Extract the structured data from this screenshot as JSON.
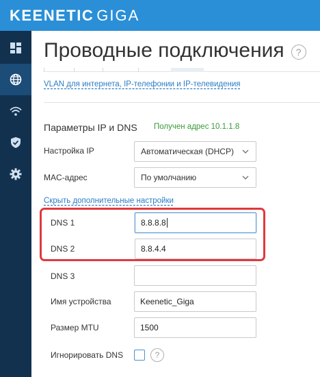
{
  "app": {
    "logo_bold": "KEENETIC",
    "logo_thin": "GIGA"
  },
  "sidebar": {
    "items": [
      {
        "icon": "dashboard-icon",
        "active": false
      },
      {
        "icon": "globe-icon",
        "active": true
      },
      {
        "icon": "wifi-icon",
        "active": false
      },
      {
        "icon": "shield-icon",
        "active": false
      },
      {
        "icon": "gear-icon",
        "active": false
      }
    ]
  },
  "page": {
    "title": "Проводные подключения",
    "help_glyph": "?",
    "vlan_link": "VLAN для интернета, IP-телефонии и IP-телевидения"
  },
  "ip_section": {
    "title": "Параметры IP и DNS",
    "status": "Получен адрес 10.1.1.8",
    "ip_setting_label": "Настройка IP",
    "ip_setting_value": "Автоматическая (DHCP)",
    "mac_label": "MAC-адрес",
    "mac_value": "По умолчанию",
    "advanced_link": "Скрыть дополнительные настройки",
    "dns1_label": "DNS 1",
    "dns1_value": "8.8.8.8",
    "dns2_label": "DNS 2",
    "dns2_value": "8.8.4.4",
    "dns3_label": "DNS 3",
    "dns3_value": "",
    "device_name_label": "Имя устройства",
    "device_name_value": "Keenetic_Giga",
    "mtu_label": "Размер MTU",
    "mtu_value": "1500",
    "ignore_dns_label": "Игнорировать DNS",
    "ignore_dns_checked": false,
    "help_glyph": "?"
  },
  "colors": {
    "header": "#2a8fd6",
    "sidebar": "#12314f",
    "sidebar_active": "#1c4c78",
    "link": "#2a7cc7",
    "status_ok": "#3a9a3a",
    "highlight": "#e0383b"
  }
}
